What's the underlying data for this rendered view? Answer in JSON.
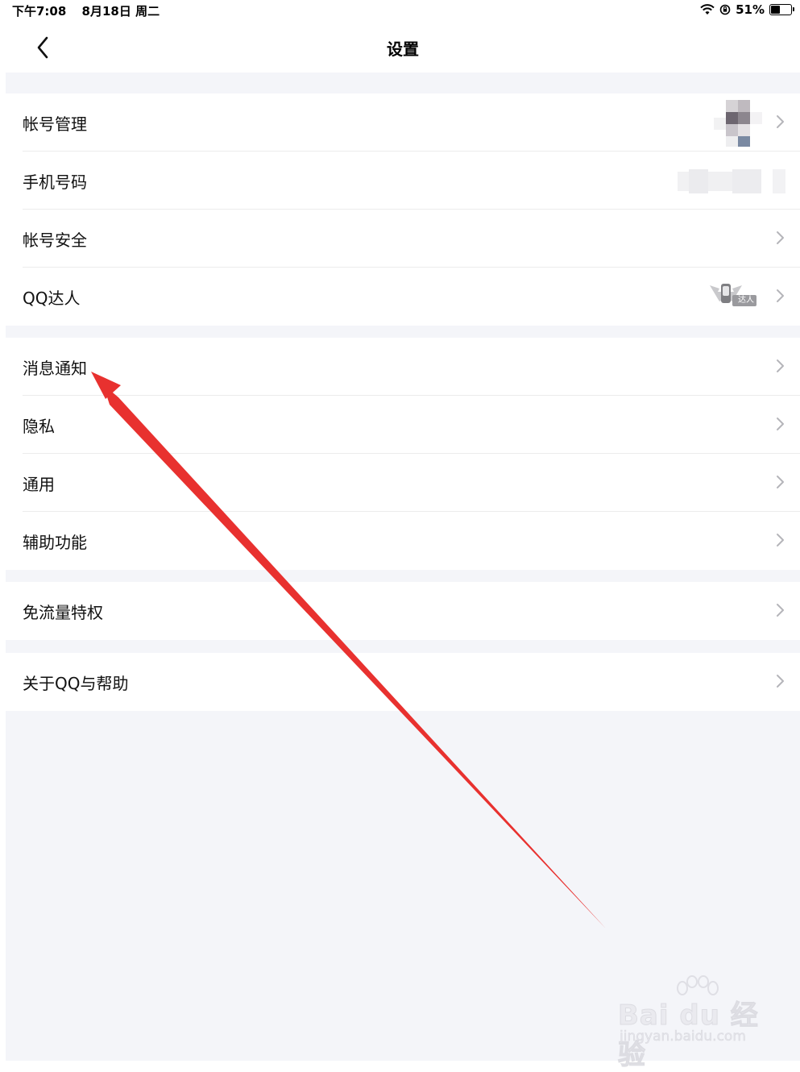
{
  "status_bar": {
    "time": "下午7:08",
    "date": "8月18日 周二",
    "battery": "51%",
    "battery_level": 0.51
  },
  "nav": {
    "title": "设置"
  },
  "groups": [
    {
      "items": [
        {
          "label": "帐号管理"
        },
        {
          "label": "手机号码"
        },
        {
          "label": "帐号安全"
        },
        {
          "label": "QQ达人"
        }
      ]
    },
    {
      "items": [
        {
          "label": "消息通知"
        },
        {
          "label": "隐私"
        },
        {
          "label": "通用"
        },
        {
          "label": "辅助功能"
        }
      ]
    },
    {
      "items": [
        {
          "label": "免流量特权"
        }
      ]
    },
    {
      "items": [
        {
          "label": "关于QQ与帮助"
        }
      ]
    }
  ],
  "badge": {
    "text": "达人"
  },
  "watermark": {
    "main": "Bai du 经验",
    "sub": "jingyan.baidu.com"
  },
  "colors": {
    "annotation_arrow": "#e8312f",
    "background": "#f4f5f9"
  }
}
